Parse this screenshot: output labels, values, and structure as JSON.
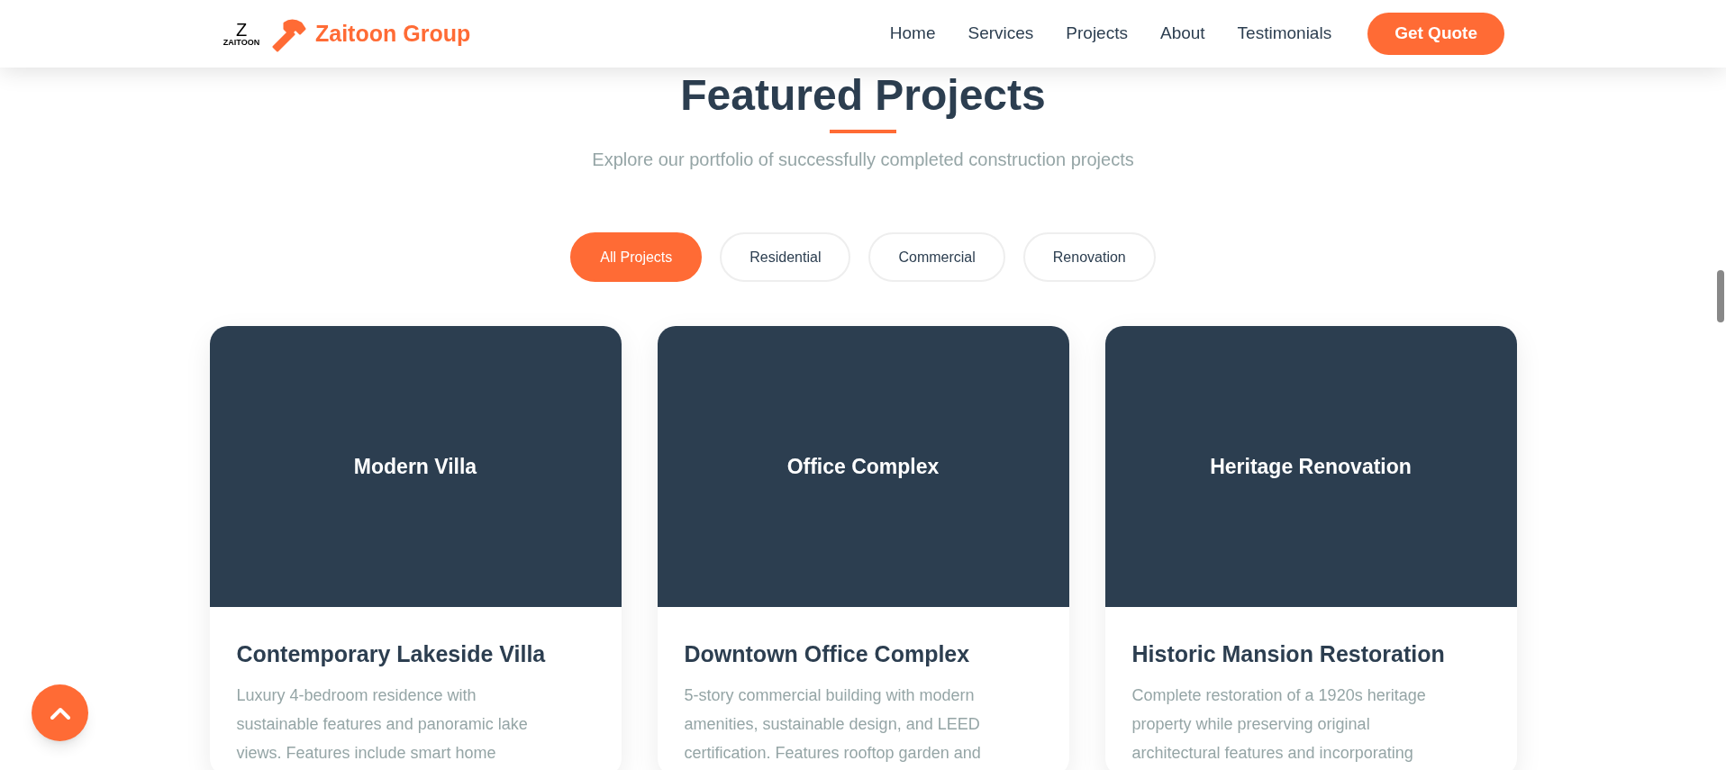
{
  "header": {
    "logo_mark": "Z",
    "logo_caption": "ZAITOON",
    "brand": "Zaitoon Group",
    "nav": [
      {
        "label": "Home"
      },
      {
        "label": "Services"
      },
      {
        "label": "Projects"
      },
      {
        "label": "About"
      },
      {
        "label": "Testimonials"
      }
    ],
    "cta": "Get Quote"
  },
  "section": {
    "title": "Featured Projects",
    "subtitle": "Explore our portfolio of successfully completed construction projects"
  },
  "filters": [
    {
      "label": "All Projects",
      "selected": true
    },
    {
      "label": "Residential",
      "selected": false
    },
    {
      "label": "Commercial",
      "selected": false
    },
    {
      "label": "Renovation",
      "selected": false
    }
  ],
  "projects": [
    {
      "image_label": "Modern Villa",
      "title": "Contemporary Lakeside Villa",
      "description": [
        "Luxury 4-bedroom residence with",
        "sustainable features and panoramic lake",
        "views. Features include smart home"
      ]
    },
    {
      "image_label": "Office Complex",
      "title": "Downtown Office Complex",
      "description": [
        "5-story commercial building with modern",
        "amenities, sustainable design, and LEED",
        "certification. Features rooftop garden and"
      ]
    },
    {
      "image_label": "Heritage Renovation",
      "title": "Historic Mansion Restoration",
      "description": [
        "Complete restoration of a 1920s heritage",
        "property while preserving original",
        "architectural features and incorporating"
      ]
    }
  ]
}
